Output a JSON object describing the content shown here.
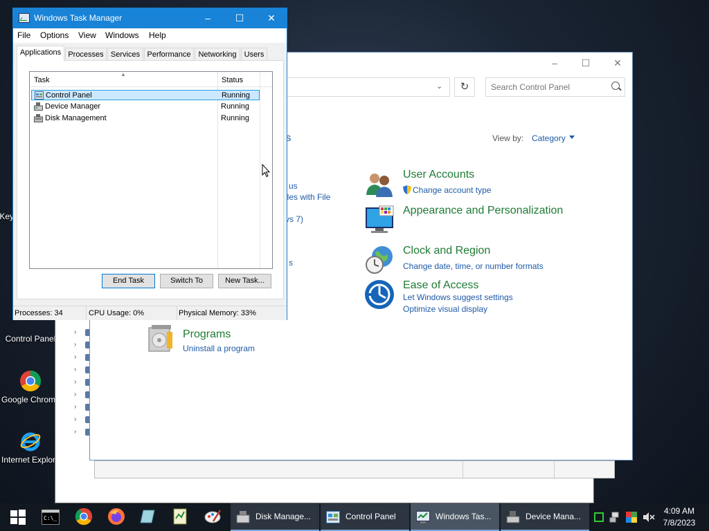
{
  "desktop": {
    "icons": [
      {
        "label": "Key"
      },
      {
        "label": "Control Panel"
      },
      {
        "label": "Google Chrome"
      },
      {
        "label": "Internet Explorer"
      }
    ]
  },
  "control_panel": {
    "search_placeholder": "Search Control Panel",
    "view_by_label": "View by:",
    "view_by_value": "Category",
    "partial_fragments": [
      "s",
      "us",
      "iles with File",
      "vs 7)",
      "s"
    ],
    "categories": [
      {
        "title": "User Accounts",
        "links": [
          "Change account type"
        ]
      },
      {
        "title": "Appearance and Personalization",
        "links": []
      },
      {
        "title": "Clock and Region",
        "links": [
          "Change date, time, or number formats"
        ]
      },
      {
        "title": "Ease of Access",
        "links": [
          "Let Windows suggest settings",
          "Optimize visual display"
        ]
      },
      {
        "title": "Programs",
        "links": [
          "Uninstall a program"
        ]
      }
    ]
  },
  "task_manager": {
    "title": "Windows Task Manager",
    "menu": [
      "File",
      "Options",
      "View",
      "Windows",
      "Help"
    ],
    "tabs": [
      "Applications",
      "Processes",
      "Services",
      "Performance",
      "Networking",
      "Users"
    ],
    "active_tab": "Applications",
    "columns": {
      "task": "Task",
      "status": "Status"
    },
    "rows": [
      {
        "task": "Control Panel",
        "status": "Running",
        "selected": true
      },
      {
        "task": "Device Manager",
        "status": "Running",
        "selected": false
      },
      {
        "task": "Disk Management",
        "status": "Running",
        "selected": false
      }
    ],
    "buttons": {
      "end_task": "End Task",
      "switch_to": "Switch To",
      "new_task": "New Task..."
    },
    "status": {
      "processes": "Processes: 34",
      "cpu": "CPU Usage: 0%",
      "memory": "Physical Memory: 33%"
    }
  },
  "taskbar": {
    "tasks": [
      {
        "label": "Disk Manage..."
      },
      {
        "label": "Control Panel"
      },
      {
        "label": "Windows Tas..."
      },
      {
        "label": "Device Mana..."
      }
    ],
    "active_task": "Windows Tas...",
    "clock": {
      "time": "4:09 AM",
      "date": "7/8/2023"
    }
  },
  "colors": {
    "accent": "#1883d7",
    "link": "#1e5aa8",
    "category_title": "#1e7a34"
  }
}
